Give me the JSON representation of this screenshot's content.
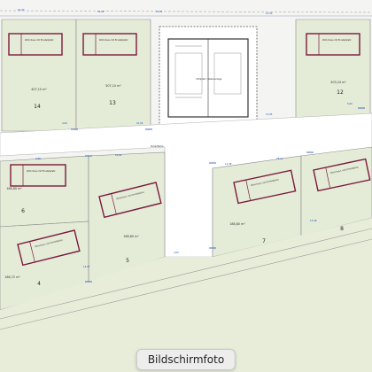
{
  "viewer": {
    "caption": "Bildschirmfoto"
  },
  "colors": {
    "lot_fill": "#e4ecd8",
    "road_fill": "#ffffff",
    "bottom_field": "#e7edd9",
    "house_outline": "#7a1a3c",
    "dimension": "#1e4fb8",
    "boundary": "#8a8a8a"
  },
  "lots": [
    {
      "number": "14",
      "area": "407,10 m²"
    },
    {
      "number": "13",
      "area": "507,10 m²"
    },
    {
      "number": "12",
      "area": "503,24 m²"
    },
    {
      "number": "6",
      "area": "186,80 m²"
    },
    {
      "number": "7",
      "area": "188,80 m²"
    },
    {
      "number": "8",
      "area": ""
    },
    {
      "number": "5",
      "area": "188,80 m²"
    },
    {
      "number": "4",
      "area": "186,72 m²"
    }
  ],
  "houses": [
    {
      "label": "Wohnhaus mit Einstellplatz"
    },
    {
      "label": "Wohnhaus mit Einstellplatz"
    },
    {
      "label": "Wohnhaus mit Einstellplatz"
    },
    {
      "label": "Wohnhaus mit Einstellplatz"
    },
    {
      "label": "Wohnhaus mit Einstellplatz"
    },
    {
      "label": "Wohnhaus mit Einstellplatz"
    },
    {
      "label": "Wohnhaus mit Einstellplatz"
    },
    {
      "label": "Wohnhaus mit Einstellplatz"
    }
  ],
  "dimensions": {
    "d1": "16,40",
    "d2": "16,00",
    "d3": "19,05",
    "d4": "11,50",
    "d5": "4,00",
    "d6": "10,95",
    "d7": "13,05",
    "d8": "5,00",
    "d9": "9,88",
    "d10": "16,82",
    "d11": "11,48",
    "d12": "23,11",
    "d13": "14,07",
    "d14": "4,00",
    "d15": "13,48"
  },
  "center_block": {
    "label": "Müllplatz / Nebenanlage"
  },
  "middle_note": "Sickerfläche"
}
